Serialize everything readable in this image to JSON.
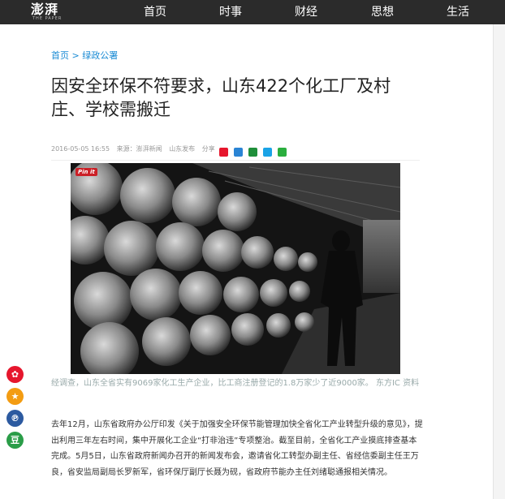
{
  "header": {
    "logo": "澎湃",
    "logo_sub": "THE PAPER",
    "nav": [
      "首页",
      "时事",
      "财经",
      "思想",
      "生活"
    ]
  },
  "breadcrumb": {
    "home": "首页",
    "separator": ">",
    "section": "绿政公署"
  },
  "article": {
    "title": "因安全环保不符要求，山东422个化工厂及村庄、学校需搬迁",
    "date": "2016-05-05 16:55",
    "source": "来源：澎湃新闻",
    "tag": "山东发布",
    "share_label": "分享",
    "pinit": "Pin it",
    "caption": "经调查，山东全省实有9069家化工生产企业，比工商注册登记的1.8万家少了近9000家。 东方IC 资料",
    "body": "去年12月，山东省政府办公厅印发《关于加强安全环保节能管理加快全省化工产业转型升级的意见》，提出利用三年左右时间，集中开展化工企业“打非治违”专项整治。截至目前，全省化工产业摸底排查基本完成。5月5日，山东省政府新闻办召开的新闻发布会，邀请省化工转型办副主任、省经信委副主任王万良，省安监局副局长罗新军，省环保厅副厅长聂为砚，省政府节能办主任刘绪聪通报相关情况。"
  },
  "share_icons": [
    "weibo-icon",
    "renren-icon",
    "douban-icon",
    "qzone-icon",
    "wechat-icon"
  ],
  "float_buttons": [
    "weibo",
    "favorite",
    "pengyou",
    "douban"
  ],
  "colors": {
    "nav_bg": "#2b2b2b",
    "link": "#1a8bd4",
    "caption": "#9aa"
  }
}
